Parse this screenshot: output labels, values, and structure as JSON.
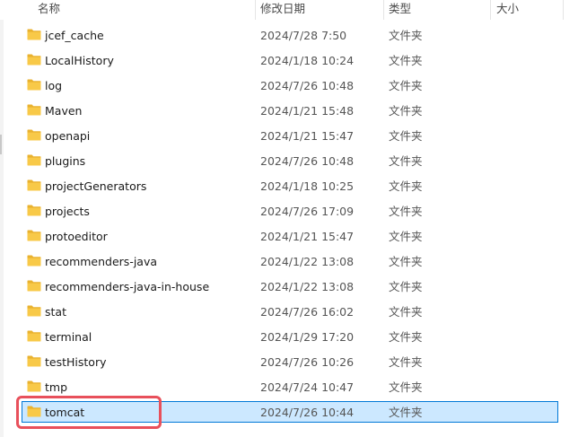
{
  "columns": {
    "name": "名称",
    "modified": "修改日期",
    "type": "类型",
    "size": "大小"
  },
  "icons": {
    "folder": "folder-icon",
    "sort": "sort-caret-icon"
  },
  "colors": {
    "folder_fill": "#f8c948",
    "folder_tab": "#e9b22f",
    "selection_bg": "#cce8ff",
    "selection_border": "#0078d7",
    "highlight_border": "#e8505b"
  },
  "rows": [
    {
      "name": "jcef_cache",
      "modified": "2024/7/28 7:50",
      "type": "文件夹",
      "selected": false
    },
    {
      "name": "LocalHistory",
      "modified": "2024/1/18 10:24",
      "type": "文件夹",
      "selected": false
    },
    {
      "name": "log",
      "modified": "2024/7/26 10:48",
      "type": "文件夹",
      "selected": false
    },
    {
      "name": "Maven",
      "modified": "2024/1/21 15:48",
      "type": "文件夹",
      "selected": false
    },
    {
      "name": "openapi",
      "modified": "2024/1/21 15:47",
      "type": "文件夹",
      "selected": false
    },
    {
      "name": "plugins",
      "modified": "2024/7/26 10:48",
      "type": "文件夹",
      "selected": false
    },
    {
      "name": "projectGenerators",
      "modified": "2024/1/18 10:25",
      "type": "文件夹",
      "selected": false
    },
    {
      "name": "projects",
      "modified": "2024/7/26 17:09",
      "type": "文件夹",
      "selected": false
    },
    {
      "name": "protoeditor",
      "modified": "2024/1/21 15:47",
      "type": "文件夹",
      "selected": false
    },
    {
      "name": "recommenders-java",
      "modified": "2024/1/22 13:08",
      "type": "文件夹",
      "selected": false
    },
    {
      "name": "recommenders-java-in-house",
      "modified": "2024/1/22 13:08",
      "type": "文件夹",
      "selected": false
    },
    {
      "name": "stat",
      "modified": "2024/7/26 16:02",
      "type": "文件夹",
      "selected": false
    },
    {
      "name": "terminal",
      "modified": "2024/1/29 17:20",
      "type": "文件夹",
      "selected": false
    },
    {
      "name": "testHistory",
      "modified": "2024/7/26 10:26",
      "type": "文件夹",
      "selected": false
    },
    {
      "name": "tmp",
      "modified": "2024/7/24 10:47",
      "type": "文件夹",
      "selected": false
    },
    {
      "name": "tomcat",
      "modified": "2024/7/26 10:44",
      "type": "文件夹",
      "selected": true
    }
  ]
}
